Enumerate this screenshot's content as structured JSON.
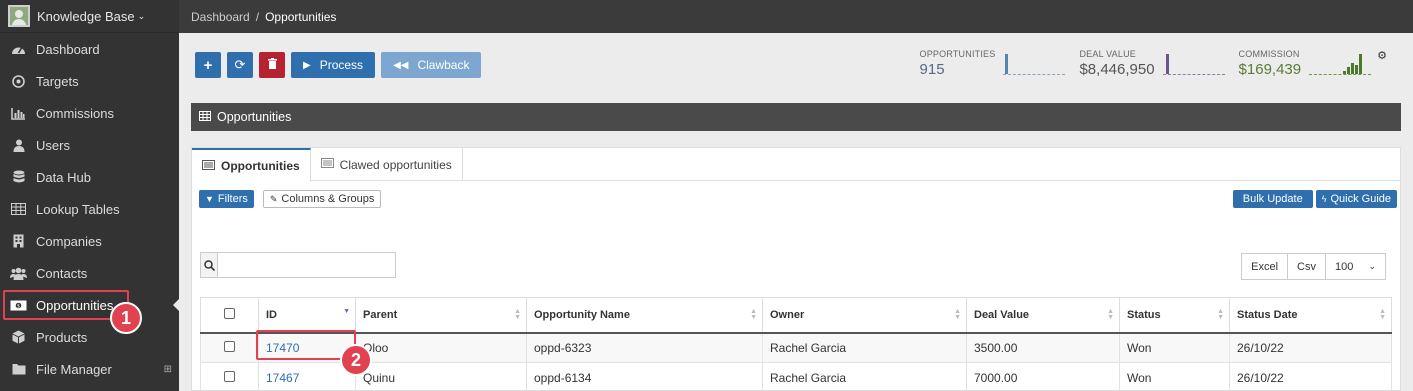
{
  "sidebar": {
    "brand": "Knowledge Base",
    "items": [
      {
        "label": "Dashboard",
        "icon": "dashboard-icon"
      },
      {
        "label": "Targets",
        "icon": "target-icon"
      },
      {
        "label": "Commissions",
        "icon": "bar-chart-icon"
      },
      {
        "label": "Users",
        "icon": "user-icon"
      },
      {
        "label": "Data Hub",
        "icon": "database-icon"
      },
      {
        "label": "Lookup Tables",
        "icon": "table-icon"
      },
      {
        "label": "Companies",
        "icon": "building-icon"
      },
      {
        "label": "Contacts",
        "icon": "users-icon"
      },
      {
        "label": "Opportunities",
        "icon": "money-icon"
      },
      {
        "label": "Products",
        "icon": "box-icon"
      },
      {
        "label": "File Manager",
        "icon": "folder-icon"
      }
    ]
  },
  "breadcrumb": {
    "root": "Dashboard",
    "separator": "/",
    "current": "Opportunities"
  },
  "toolbar": {
    "process_label": "Process",
    "clawback_label": "Clawback"
  },
  "stats": {
    "opportunities": {
      "label": "OPPORTUNITIES",
      "value": "915"
    },
    "deal_value": {
      "label": "DEAL VALUE",
      "value": "$8,446,950"
    },
    "commission": {
      "label": "COMMISSION",
      "value": "$169,439"
    }
  },
  "panel": {
    "title": "Opportunities"
  },
  "tabs": [
    {
      "label": "Opportunities"
    },
    {
      "label": "Clawed opportunities"
    }
  ],
  "buttons": {
    "filters": "Filters",
    "columns_groups": "Columns & Groups",
    "bulk_update": "Bulk Update",
    "quick_guide": "Quick Guide",
    "excel": "Excel",
    "csv": "Csv",
    "page_size": "100"
  },
  "search": {
    "placeholder": ""
  },
  "table": {
    "headers": [
      "ID",
      "Parent",
      "Opportunity Name",
      "Owner",
      "Deal Value",
      "Status",
      "Status Date"
    ],
    "rows": [
      {
        "id": "17470",
        "parent": "Oloo",
        "name": "oppd-6323",
        "owner": "Rachel Garcia",
        "deal_value": "3500.00",
        "status": "Won",
        "date": "26/10/22"
      },
      {
        "id": "17467",
        "parent": "Quinu",
        "name": "oppd-6134",
        "owner": "Rachel Garcia",
        "deal_value": "7000.00",
        "status": "Won",
        "date": "26/10/22"
      }
    ]
  },
  "annotations": {
    "step1": "1",
    "step2": "2"
  },
  "colors": {
    "accent": "#2f6fae",
    "annotation": "#e0434f",
    "sidebar": "#333333"
  }
}
